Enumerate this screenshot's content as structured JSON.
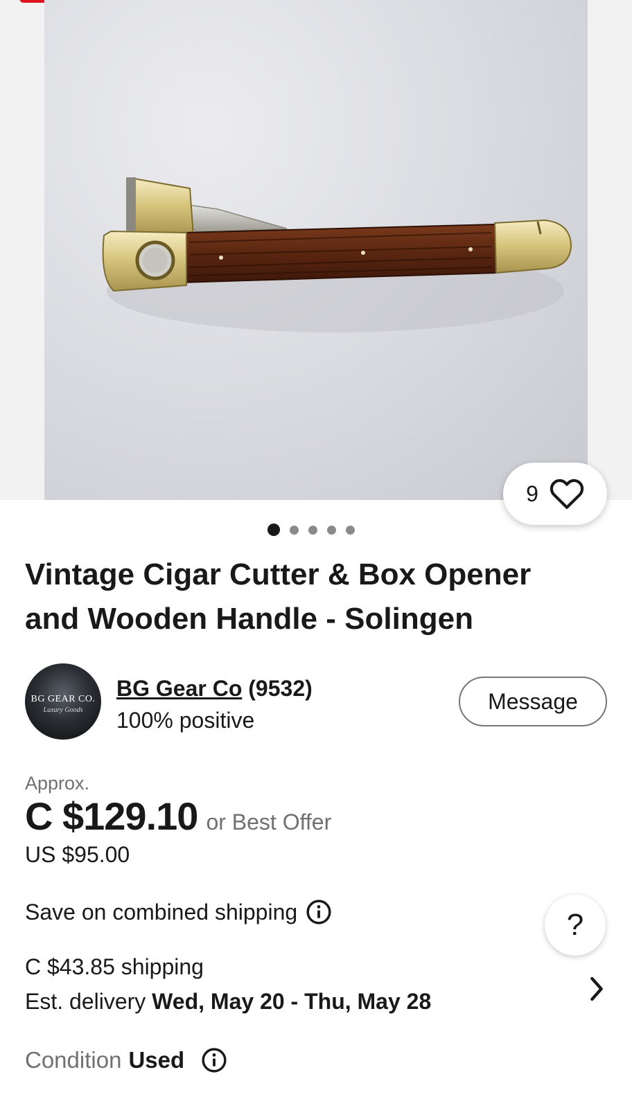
{
  "gallery": {
    "like_count": "9",
    "dot_count": 5,
    "active_dot": 0
  },
  "listing": {
    "title_line1": "Vintage Cigar Cutter & Box Opener",
    "title_line2": "and Wooden Handle - Solingen"
  },
  "seller": {
    "name": "BG Gear Co",
    "score": "(9532)",
    "feedback": "100% positive",
    "logo_text": "BG GEAR CO.",
    "logo_subtext": "Luxury Goods",
    "message_label": "Message"
  },
  "price": {
    "approx_label": "Approx.",
    "converted": "C $129.10",
    "best_offer": "or Best Offer",
    "original": "US $95.00"
  },
  "shipping": {
    "combined_label": "Save on combined shipping",
    "cost": "C $43.85 shipping",
    "est_label": "Est. delivery",
    "est_range": "Wed, May 20 - Thu, May 28"
  },
  "condition": {
    "label": "Condition",
    "value": "Used"
  },
  "help": {
    "label": "?"
  },
  "colors": {
    "accent_red": "#e0141e",
    "text_primary": "#191919",
    "text_secondary": "#707070"
  },
  "icons": {
    "like": "heart-icon",
    "info": "info-icon",
    "chevron": "chevron-right-icon"
  }
}
